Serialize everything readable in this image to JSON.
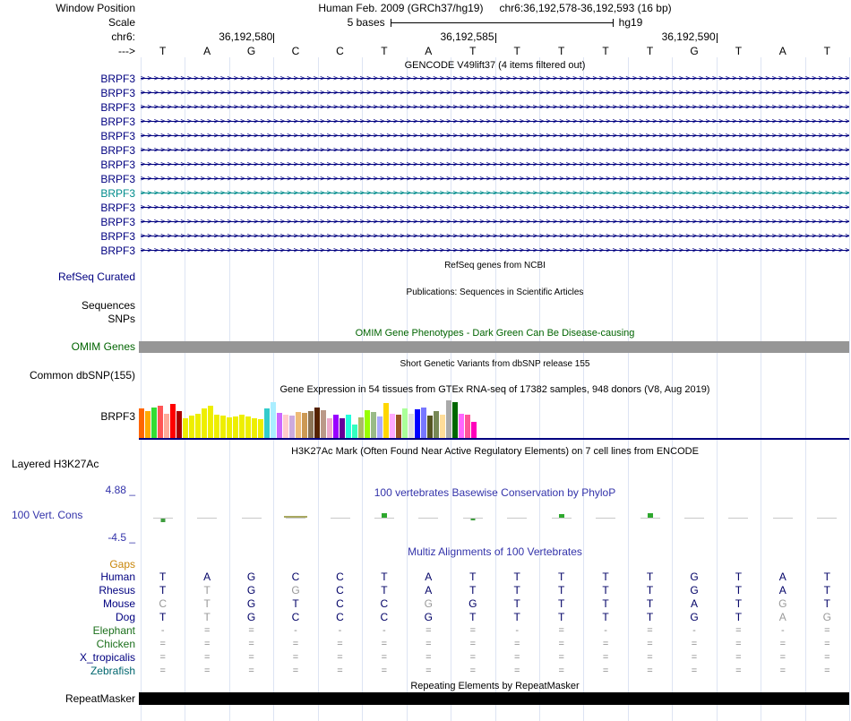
{
  "header": {
    "window_position_label": "Window Position",
    "assembly_title": "Human Feb. 2009 (GRCh37/hg19)",
    "position_title": "chr6:36,192,578-36,192,593 (16 bp)",
    "scale_label": "Scale",
    "scale_bar_text": "5 bases",
    "assembly_short": "hg19",
    "chrom_label": "chr6:",
    "strand_label": "--->",
    "coordinates": [
      {
        "text": "36,192,580",
        "boundary": 3
      },
      {
        "text": "36,192,585",
        "boundary": 8
      },
      {
        "text": "36,192,590",
        "boundary": 13
      }
    ],
    "sequence": [
      "T",
      "A",
      "G",
      "C",
      "C",
      "T",
      "A",
      "T",
      "T",
      "T",
      "T",
      "T",
      "G",
      "T",
      "A",
      "T"
    ]
  },
  "gencode": {
    "title": "GENCODE V49lift37 (4 items filtered out)",
    "transcripts": [
      {
        "label": "BRPF3",
        "color": "#000080"
      },
      {
        "label": "BRPF3",
        "color": "#000080"
      },
      {
        "label": "BRPF3",
        "color": "#000080"
      },
      {
        "label": "BRPF3",
        "color": "#000080"
      },
      {
        "label": "BRPF3",
        "color": "#000080"
      },
      {
        "label": "BRPF3",
        "color": "#000080"
      },
      {
        "label": "BRPF3",
        "color": "#000080"
      },
      {
        "label": "BRPF3",
        "color": "#000080"
      },
      {
        "label": "BRPF3",
        "color": "#008c8c"
      },
      {
        "label": "BRPF3",
        "color": "#000080"
      },
      {
        "label": "BRPF3",
        "color": "#000080"
      },
      {
        "label": "BRPF3",
        "color": "#000080"
      },
      {
        "label": "BRPF3",
        "color": "#000080"
      }
    ]
  },
  "refseq": {
    "title": "RefSeq genes from NCBI",
    "label": "RefSeq Curated"
  },
  "publications": {
    "title": "Publications: Sequences in Scientific Articles",
    "sequences_label": "Sequences",
    "snps_label": "SNPs"
  },
  "omim": {
    "title": "OMIM Gene Phenotypes - Dark Green Can Be Disease-causing",
    "label": "OMIM Genes",
    "bar_color": "#969696"
  },
  "dbsnp": {
    "title": "Short Genetic Variants from dbSNP release 155",
    "label": "Common dbSNP(155)"
  },
  "gtex": {
    "title": "Gene Expression in 54 tissues from GTEx RNA-seq of 17382 samples, 948 donors (V8, Aug 2019)",
    "gene_label": "BRPF3",
    "baseline_color": "#000080",
    "bars": [
      {
        "c": "#FF6600",
        "h": 33
      },
      {
        "c": "#FFAA00",
        "h": 30
      },
      {
        "c": "#33DD33",
        "h": 34
      },
      {
        "c": "#FF5555",
        "h": 36
      },
      {
        "c": "#FFAA99",
        "h": 27
      },
      {
        "c": "#FF0000",
        "h": 38
      },
      {
        "c": "#AA0000",
        "h": 30
      },
      {
        "c": "#EEEE00",
        "h": 22
      },
      {
        "c": "#EEEE00",
        "h": 25
      },
      {
        "c": "#EEEE00",
        "h": 27
      },
      {
        "c": "#EEEE00",
        "h": 33
      },
      {
        "c": "#EEEE00",
        "h": 36
      },
      {
        "c": "#EEEE00",
        "h": 26
      },
      {
        "c": "#EEEE00",
        "h": 25
      },
      {
        "c": "#EEEE00",
        "h": 23
      },
      {
        "c": "#EEEE00",
        "h": 24
      },
      {
        "c": "#EEEE00",
        "h": 26
      },
      {
        "c": "#EEEE00",
        "h": 24
      },
      {
        "c": "#EEEE00",
        "h": 22
      },
      {
        "c": "#EEEE00",
        "h": 21
      },
      {
        "c": "#33CCCC",
        "h": 33
      },
      {
        "c": "#AAEEFF",
        "h": 40
      },
      {
        "c": "#CC66FF",
        "h": 28
      },
      {
        "c": "#FFCCCC",
        "h": 26
      },
      {
        "c": "#CCAADD",
        "h": 25
      },
      {
        "c": "#EEBB77",
        "h": 29
      },
      {
        "c": "#CC9955",
        "h": 28
      },
      {
        "c": "#8B7355",
        "h": 30
      },
      {
        "c": "#552200",
        "h": 34
      },
      {
        "c": "#BB9988",
        "h": 31
      },
      {
        "c": "#EEAACC",
        "h": 22
      },
      {
        "c": "#9900FF",
        "h": 26
      },
      {
        "c": "#660099",
        "h": 22
      },
      {
        "c": "#22FFDD",
        "h": 26
      },
      {
        "c": "#33FFC0",
        "h": 15
      },
      {
        "c": "#AABB66",
        "h": 23
      },
      {
        "c": "#99FF00",
        "h": 31
      },
      {
        "c": "#99BB88",
        "h": 29
      },
      {
        "c": "#AAAAFF",
        "h": 24
      },
      {
        "c": "#FFD700",
        "h": 39
      },
      {
        "c": "#FFAAFF",
        "h": 27
      },
      {
        "c": "#995522",
        "h": 26
      },
      {
        "c": "#AAFF99",
        "h": 33
      },
      {
        "c": "#DDDDDD",
        "h": 27
      },
      {
        "c": "#0000FF",
        "h": 32
      },
      {
        "c": "#7777FF",
        "h": 34
      },
      {
        "c": "#555522",
        "h": 25
      },
      {
        "c": "#778855",
        "h": 30
      },
      {
        "c": "#FFDD99",
        "h": 26
      },
      {
        "c": "#AAAAAA",
        "h": 42
      },
      {
        "c": "#006600",
        "h": 40
      },
      {
        "c": "#FF66FF",
        "h": 27
      },
      {
        "c": "#FF5599",
        "h": 26
      },
      {
        "c": "#FF00BB",
        "h": 18
      }
    ]
  },
  "h3k27ac": {
    "title": "H3K27Ac Mark (Often Found Near Active Regulatory Elements) on 7 cell lines from ENCODE",
    "label": "Layered H3K27Ac"
  },
  "conservation": {
    "title": "100 vertebrates Basewise Conservation by PhyloP",
    "label": "100 Vert. Cons",
    "max_label": "4.88 _",
    "min_label": "-4.5 _",
    "accent_color": "#3333aa",
    "marks": [
      {
        "col": 1,
        "dir": "down",
        "h": 4,
        "w": 5,
        "color": "#3f9e3f"
      },
      {
        "col": 4,
        "dir": "up",
        "h": 2,
        "w": 26,
        "color": "#a8a860"
      },
      {
        "col": 6,
        "dir": "up",
        "h": 5,
        "w": 6,
        "color": "#2ea82e"
      },
      {
        "col": 8,
        "dir": "down",
        "h": 2,
        "w": 5,
        "color": "#3f9e3f"
      },
      {
        "col": 10,
        "dir": "up",
        "h": 4,
        "w": 6,
        "color": "#2ea82e"
      },
      {
        "col": 12,
        "dir": "up",
        "h": 5,
        "w": 6,
        "color": "#2ea82e"
      }
    ]
  },
  "multiz": {
    "title": "Multiz Alignments of 100 Vertebrates",
    "gaps_label": "Gaps",
    "species": [
      {
        "name": "Human",
        "color": "#000080",
        "gap": false,
        "dim": [],
        "tokens": [
          "T",
          "A",
          "G",
          "C",
          "C",
          "T",
          "A",
          "T",
          "T",
          "T",
          "T",
          "T",
          "G",
          "T",
          "A",
          "T"
        ]
      },
      {
        "name": "Rhesus",
        "color": "#000080",
        "gap": false,
        "dim": [
          1,
          3
        ],
        "tokens": [
          "T",
          "T",
          "G",
          "G",
          "C",
          "T",
          "A",
          "T",
          "T",
          "T",
          "T",
          "T",
          "G",
          "T",
          "A",
          "T"
        ]
      },
      {
        "name": "Mouse",
        "color": "#000080",
        "gap": false,
        "dim": [
          0,
          1,
          6,
          14
        ],
        "tokens": [
          "C",
          "T",
          "G",
          "T",
          "C",
          "C",
          "G",
          "G",
          "T",
          "T",
          "T",
          "T",
          "A",
          "T",
          "G",
          "T"
        ]
      },
      {
        "name": "Dog",
        "color": "#000080",
        "gap": false,
        "dim": [
          1,
          14,
          15
        ],
        "tokens": [
          "T",
          "T",
          "G",
          "C",
          "C",
          "C",
          "G",
          "T",
          "T",
          "T",
          "T",
          "T",
          "G",
          "T",
          "A",
          "G"
        ]
      },
      {
        "name": "Elephant",
        "color": "#1c701c",
        "gap": true,
        "dim": [],
        "tokens": [
          "-",
          "=",
          "=",
          "-",
          "-",
          "-",
          "=",
          "=",
          "-",
          "=",
          "-",
          "=",
          "-",
          "=",
          "-",
          "="
        ]
      },
      {
        "name": "Chicken",
        "color": "#1c701c",
        "gap": true,
        "dim": [],
        "tokens": [
          "=",
          "=",
          "=",
          "=",
          "=",
          "=",
          "=",
          "=",
          "=",
          "=",
          "=",
          "=",
          "=",
          "=",
          "=",
          "="
        ]
      },
      {
        "name": "X_tropicalis",
        "color": "#000080",
        "gap": true,
        "dim": [],
        "tokens": [
          "=",
          "=",
          "=",
          "=",
          "=",
          "=",
          "=",
          "=",
          "=",
          "=",
          "=",
          "=",
          "=",
          "=",
          "=",
          "="
        ]
      },
      {
        "name": "Zebrafish",
        "color": "#00666e",
        "gap": true,
        "dim": [],
        "tokens": [
          "=",
          "=",
          "=",
          "=",
          "=",
          "=",
          "=",
          "=",
          "=",
          "=",
          "=",
          "=",
          "=",
          "=",
          "=",
          "="
        ]
      }
    ]
  },
  "repeatmasker": {
    "title": "Repeating Elements by RepeatMasker",
    "label": "RepeatMasker",
    "bar_color": "#000000"
  }
}
